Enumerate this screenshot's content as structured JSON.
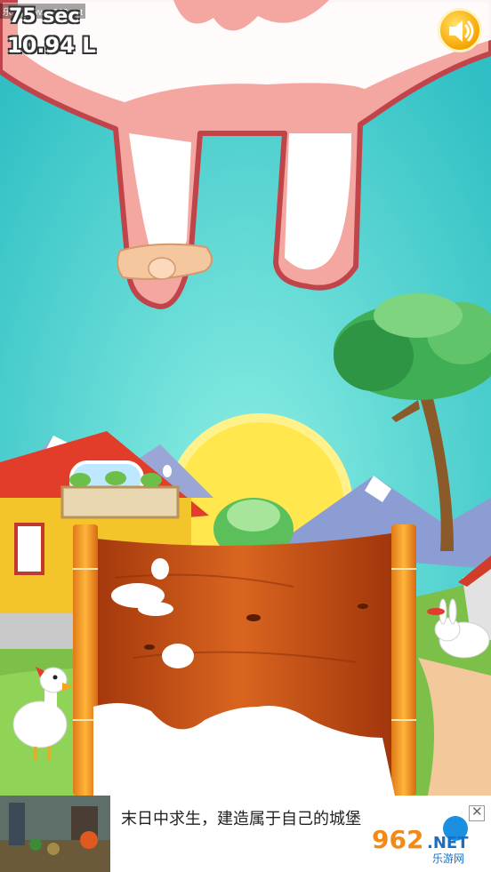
{
  "hud": {
    "timer": "75 sec",
    "liters": "10.94 L"
  },
  "watermark": "乐游网 www.962.net",
  "sound_button": {
    "icon": "speaker-icon"
  },
  "ad": {
    "text": "末日中求生，建造属于自己的城堡",
    "close_icon": "close-icon",
    "logo": {
      "brand": "962",
      "suffix": ".NET",
      "sub": "乐游网"
    }
  },
  "colors": {
    "sky": "#3fc9c8",
    "udder": "#f4a6a0",
    "udder_outline": "#c0454a",
    "milk": "#ffffff",
    "wood": "#c8541a",
    "sound_button": "#f7a400"
  }
}
